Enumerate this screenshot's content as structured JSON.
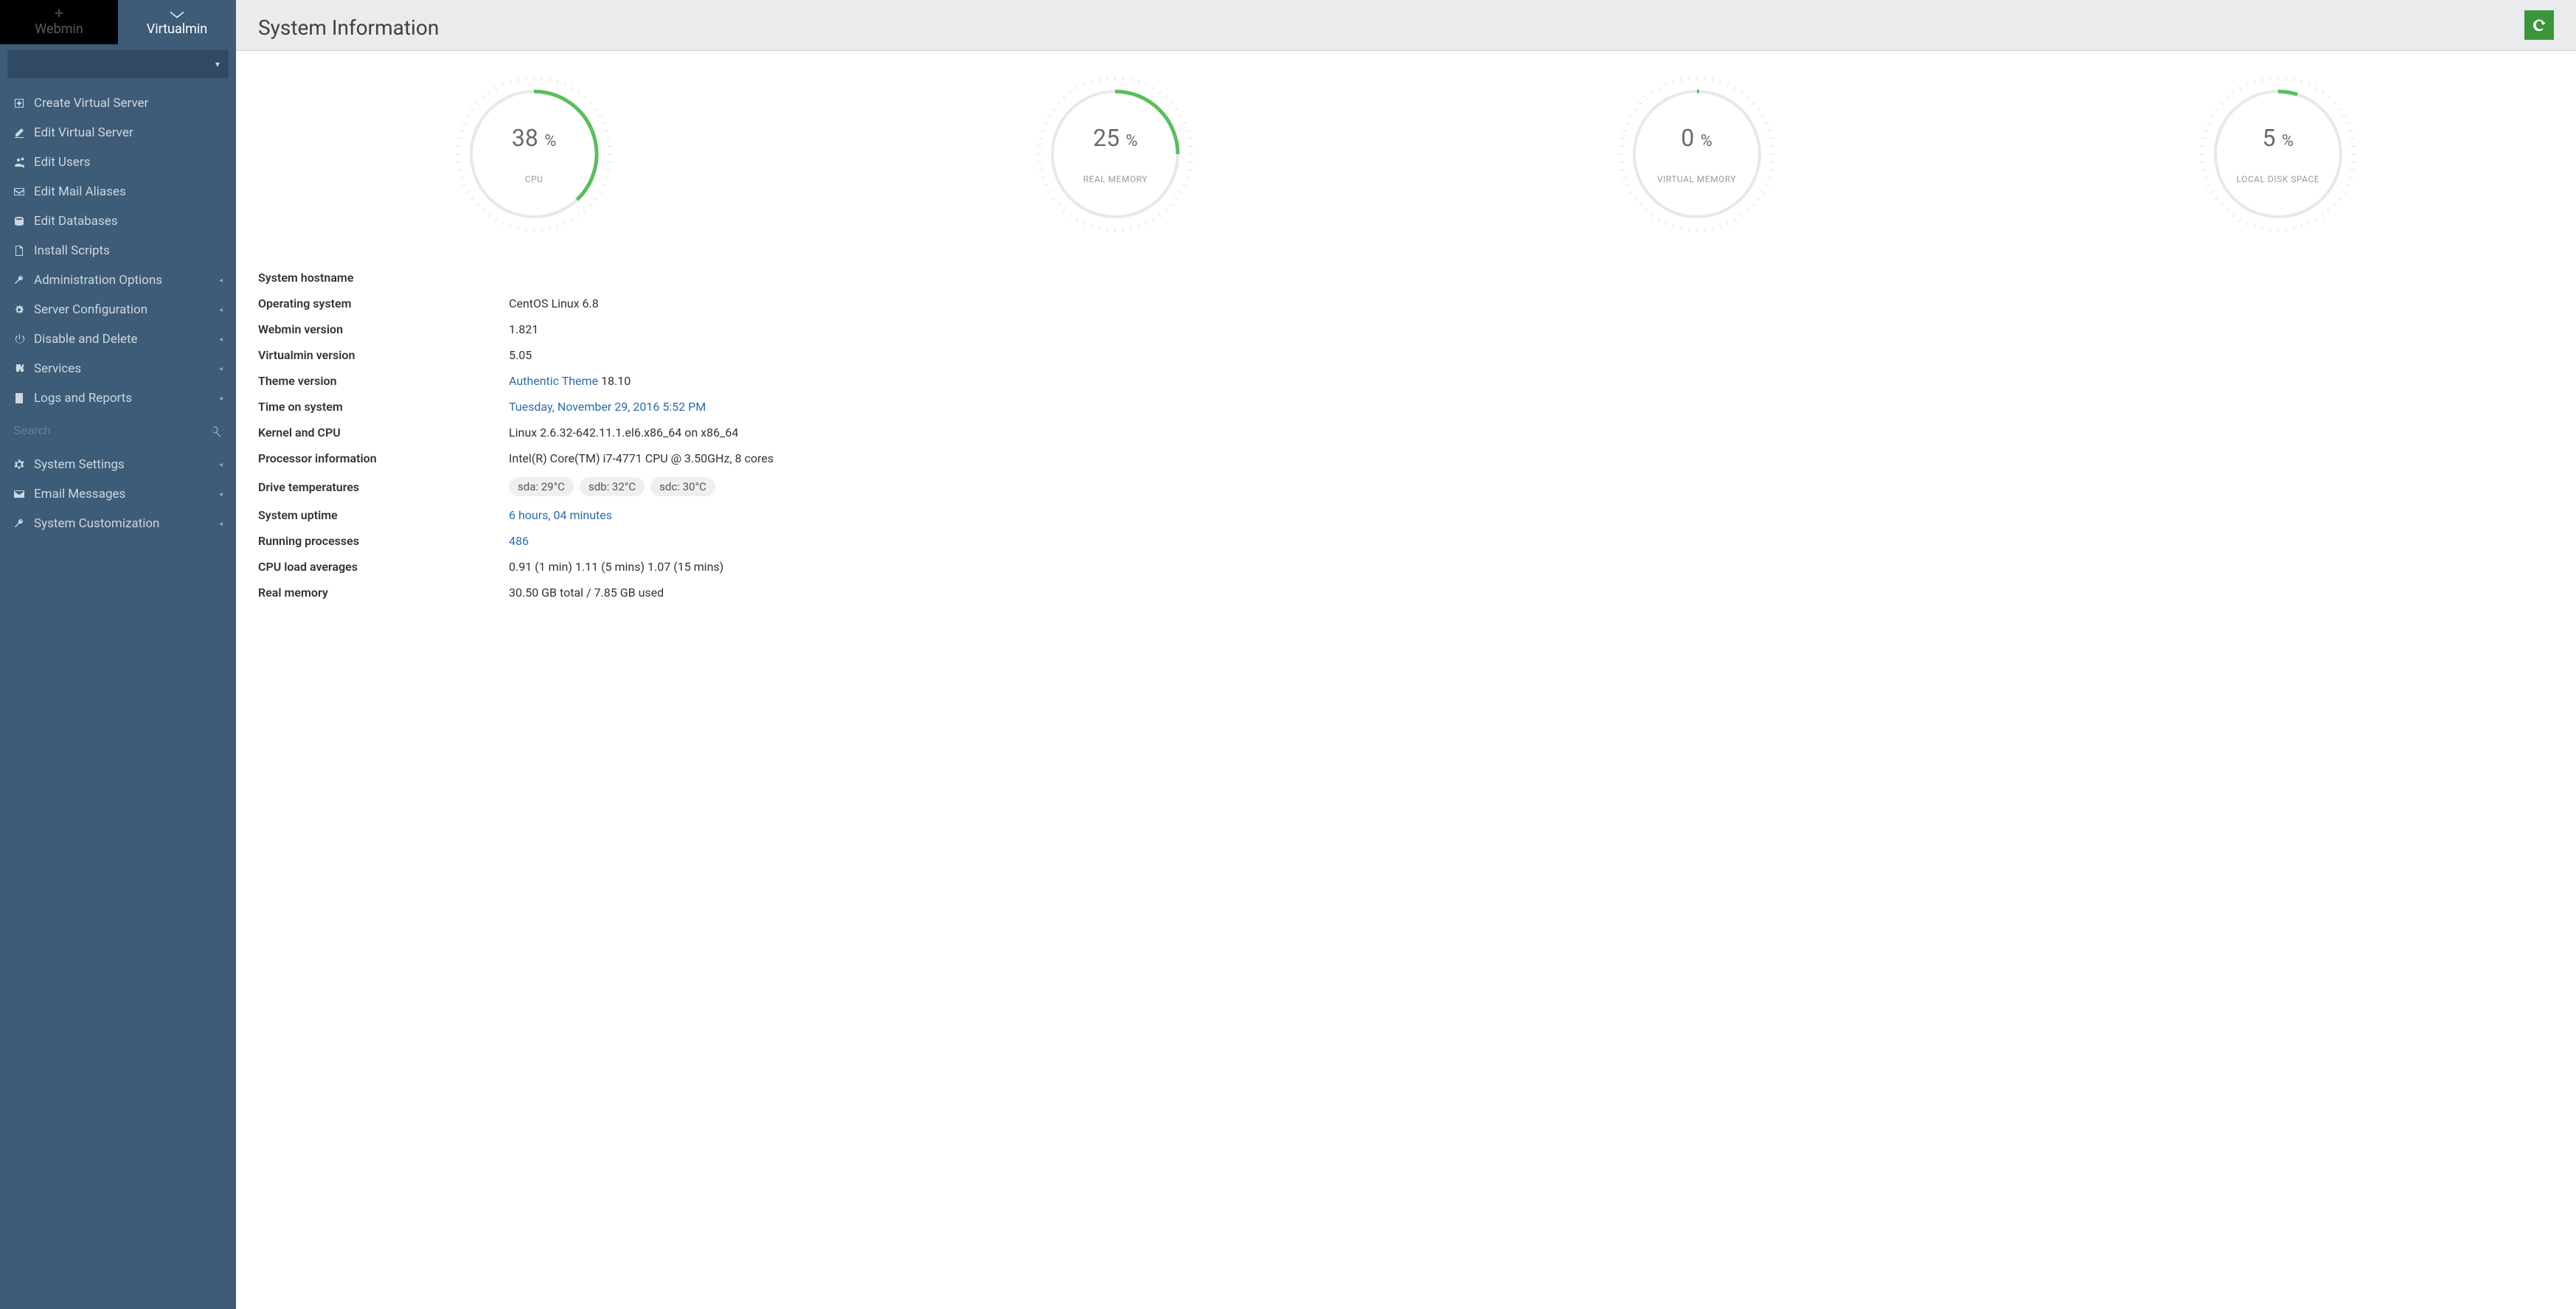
{
  "tabs": {
    "webmin": "Webmin",
    "virtualmin": "Virtualmin"
  },
  "sidebar": {
    "items": [
      {
        "label": "Create Virtual Server"
      },
      {
        "label": "Edit Virtual Server"
      },
      {
        "label": "Edit Users"
      },
      {
        "label": "Edit Mail Aliases"
      },
      {
        "label": "Edit Databases"
      },
      {
        "label": "Install Scripts"
      },
      {
        "label": "Administration Options"
      },
      {
        "label": "Server Configuration"
      },
      {
        "label": "Disable and Delete"
      },
      {
        "label": "Services"
      },
      {
        "label": "Logs and Reports"
      }
    ],
    "search_placeholder": "Search",
    "footer": [
      {
        "label": "System Settings"
      },
      {
        "label": "Email Messages"
      },
      {
        "label": "System Customization"
      }
    ]
  },
  "page_title": "System Information",
  "chart_data": [
    {
      "type": "gauge",
      "label": "CPU",
      "value": 38,
      "unit": "%",
      "max": 100
    },
    {
      "type": "gauge",
      "label": "REAL MEMORY",
      "value": 25,
      "unit": "%",
      "max": 100
    },
    {
      "type": "gauge",
      "label": "VIRTUAL MEMORY",
      "value": 0,
      "unit": "%",
      "max": 100
    },
    {
      "type": "gauge",
      "label": "LOCAL DISK SPACE",
      "value": 5,
      "unit": "%",
      "max": 100
    }
  ],
  "info": {
    "hostname_label": "System hostname",
    "hostname_value": "",
    "os_label": "Operating system",
    "os_value": "CentOS Linux 6.8",
    "webmin_label": "Webmin version",
    "webmin_value": "1.821",
    "virtualmin_label": "Virtualmin version",
    "virtualmin_value": "5.05",
    "theme_label": "Theme version",
    "theme_name": "Authentic Theme",
    "theme_version": "18.10",
    "time_label": "Time on system",
    "time_value": "Tuesday, November 29, 2016 5:52 PM",
    "kernel_label": "Kernel and CPU",
    "kernel_value": "Linux 2.6.32-642.11.1.el6.x86_64 on x86_64",
    "cpu_label": "Processor information",
    "cpu_value": "Intel(R) Core(TM) i7-4771 CPU @ 3.50GHz, 8 cores",
    "drives_label": "Drive temperatures",
    "drives": [
      "sda: 29°C",
      "sdb: 32°C",
      "sdc: 30°C"
    ],
    "uptime_label": "System uptime",
    "uptime_value": "6 hours, 04 minutes",
    "procs_label": "Running processes",
    "procs_value": "486",
    "load_label": "CPU load averages",
    "load_value": "0.91 (1 min) 1.11 (5 mins) 1.07 (15 mins)",
    "mem_label": "Real memory",
    "mem_value": "30.50 GB total / 7.85 GB used"
  }
}
